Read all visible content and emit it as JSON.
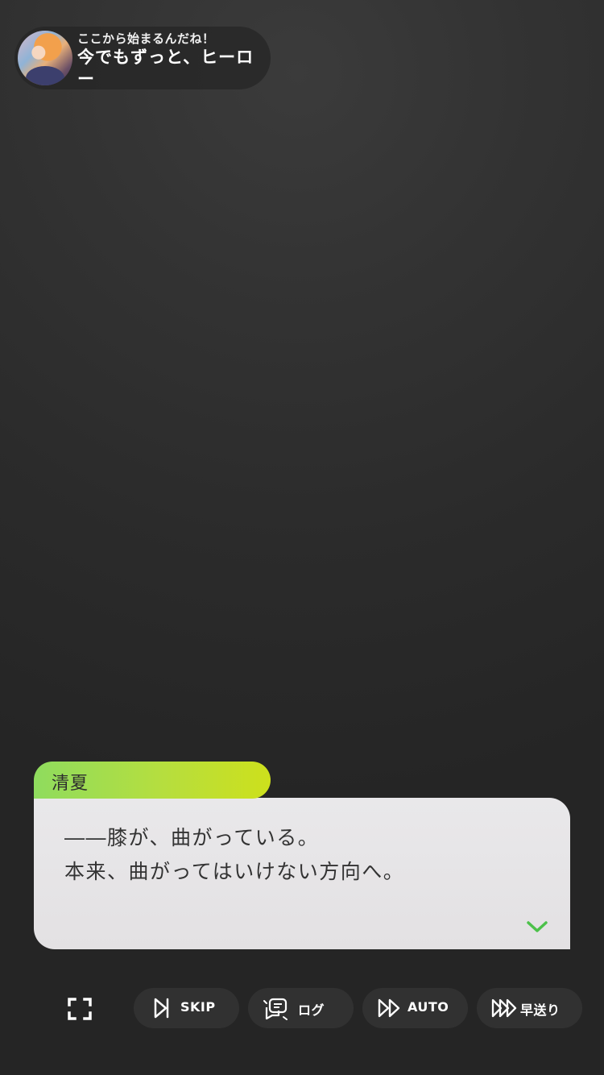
{
  "episode": {
    "subtitle": "ここから始まるんだね！",
    "title": "今でもずっと、ヒーロー"
  },
  "dialogue": {
    "speaker": "清夏",
    "lines": [
      "――膝が、曲がっている。",
      "本来、曲がってはいけない方向へ。"
    ],
    "accent_color": "#4cc14a"
  },
  "controls": {
    "skip_label": "SKIP",
    "log_label": "ログ",
    "auto_label": "AUTO",
    "fast_forward_label": "早送り"
  },
  "colors": {
    "name_tag_gradient_start": "#8fdc5e",
    "name_tag_gradient_end": "#cde01c",
    "dialogue_box": "#e6e4e6",
    "background": "#2e2e2e"
  }
}
